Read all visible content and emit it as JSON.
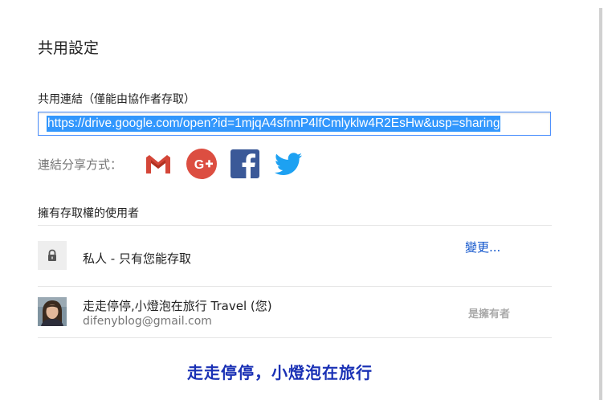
{
  "dialog": {
    "title": "共用設定"
  },
  "link_section": {
    "label": "共用連結（僅能由協作者存取）",
    "url": "https://drive.google.com/open?id=1mjqA4sfnnP4lfCmlyklw4R2EsHw&usp=sharing"
  },
  "share_via": {
    "label": "連結分享方式：",
    "services": [
      "gmail-icon",
      "google-plus-icon",
      "facebook-icon",
      "twitter-icon"
    ]
  },
  "access": {
    "heading": "擁有存取權的使用者",
    "visibility_text": "私人 - 只有您能存取",
    "change_label": "變更...",
    "owner": {
      "name": "走走停停,小燈泡在旅行 Travel (您)",
      "email": "difenyblog@gmail.com",
      "role": "是擁有者"
    }
  },
  "watermark": {
    "text": "走走停停，小燈泡在旅行"
  },
  "colors": {
    "link_blue": "#1155cc",
    "selection_blue": "#3297fd",
    "input_focus": "#4d90fe",
    "gmail_red": "#d44638",
    "gplus_red": "#dc4e41",
    "facebook_blue": "#3b5998",
    "twitter_blue": "#1da1f2",
    "watermark_blue": "#1a31b5"
  }
}
